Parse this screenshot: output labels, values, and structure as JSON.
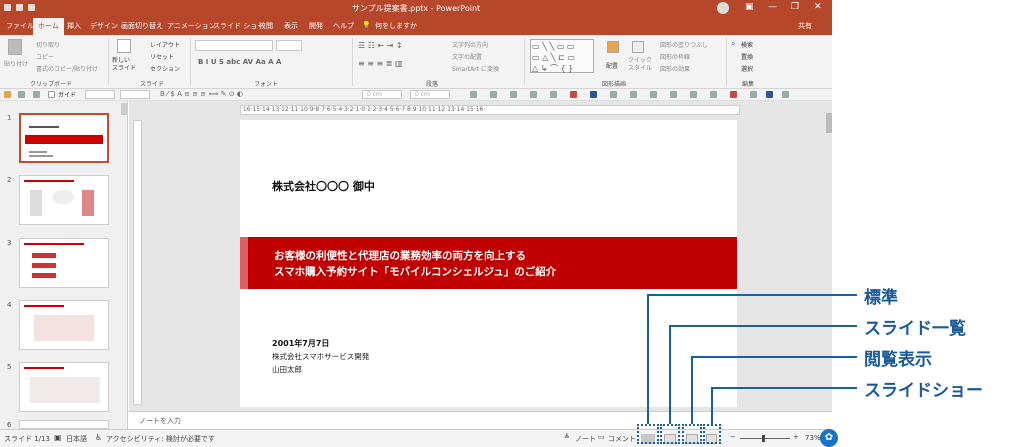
{
  "window": {
    "title": "サンプル提案書.pptx  -  PowerPoint",
    "controls": [
      "▣",
      "—",
      "❐",
      "✕"
    ]
  },
  "tabs": [
    "ファイル",
    "ホーム",
    "挿入",
    "デザイン",
    "画面切り替え",
    "アニメーション",
    "スライド ショー",
    "校閲",
    "表示",
    "開発",
    "ヘルプ",
    "何をしますか"
  ],
  "share": "共有",
  "ribbon": {
    "clipboard": {
      "paste": "貼り付け",
      "cut": "切り取り",
      "copy": "コピー",
      "format_painter": "書式のコピー/貼り付け",
      "label": "クリップボード"
    },
    "slides": {
      "new_slide": "新しい\nスライド",
      "layout": "レイアウト",
      "reset": "リセット",
      "section": "セクション",
      "label": "スライド"
    },
    "font": {
      "label": "フォント"
    },
    "paragraph": {
      "text_direction": "文字列の方向",
      "align_text": "文字の配置",
      "smartart": "SmartArt に変換",
      "label": "段落"
    },
    "drawing": {
      "arrange": "配置",
      "quick_styles": "クイック\nスタイル",
      "shape_fill": "図形の塗りつぶし",
      "shape_outline": "図形の枠線",
      "shape_effects": "図形の効果",
      "label": "図形描画"
    },
    "editing": {
      "find": "検索",
      "replace": "置換",
      "select": "選択",
      "label": "編集"
    }
  },
  "toolbar2": {
    "guide": "ガイド",
    "size_w": "0 cm",
    "size_h": "0 cm"
  },
  "ruler": {
    "marks": "·16·15·14·13·12·11·10·9·8·7·6·5·4·3·2·1·0·1·2·3·4·5·6·7·8·9·10·11·12·13·14·15·16·"
  },
  "thumbnails": [
    1,
    2,
    3,
    4,
    5,
    6
  ],
  "slide": {
    "addressee": "株式会社〇〇〇 御中",
    "banner_line1": "お客様の利便性と代理店の業務効率の両方を向上する",
    "banner_line2": "スマホ購入予約サイト「モバイルコンシェルジュ」のご紹介",
    "date": "2001年7月7日",
    "company": "株式会社スマホサービス開発",
    "person": "山田太郎"
  },
  "notes": {
    "placeholder": "ノートを入力"
  },
  "status": {
    "slide_count": "スライド 1/13",
    "language": "日本語",
    "accessibility": "アクセシビリティ: 検討が必要です",
    "notes_button": "ノート",
    "comments_button": "コメント",
    "zoom": "73%"
  },
  "callouts": {
    "normal": "標準",
    "slide_sorter": "スライド一覧",
    "reading_view": "閲覧表示",
    "slideshow": "スライドショー"
  },
  "colors": {
    "accent": "#b7472a",
    "banner": "#c00000",
    "callout": "#1a5a9c"
  }
}
